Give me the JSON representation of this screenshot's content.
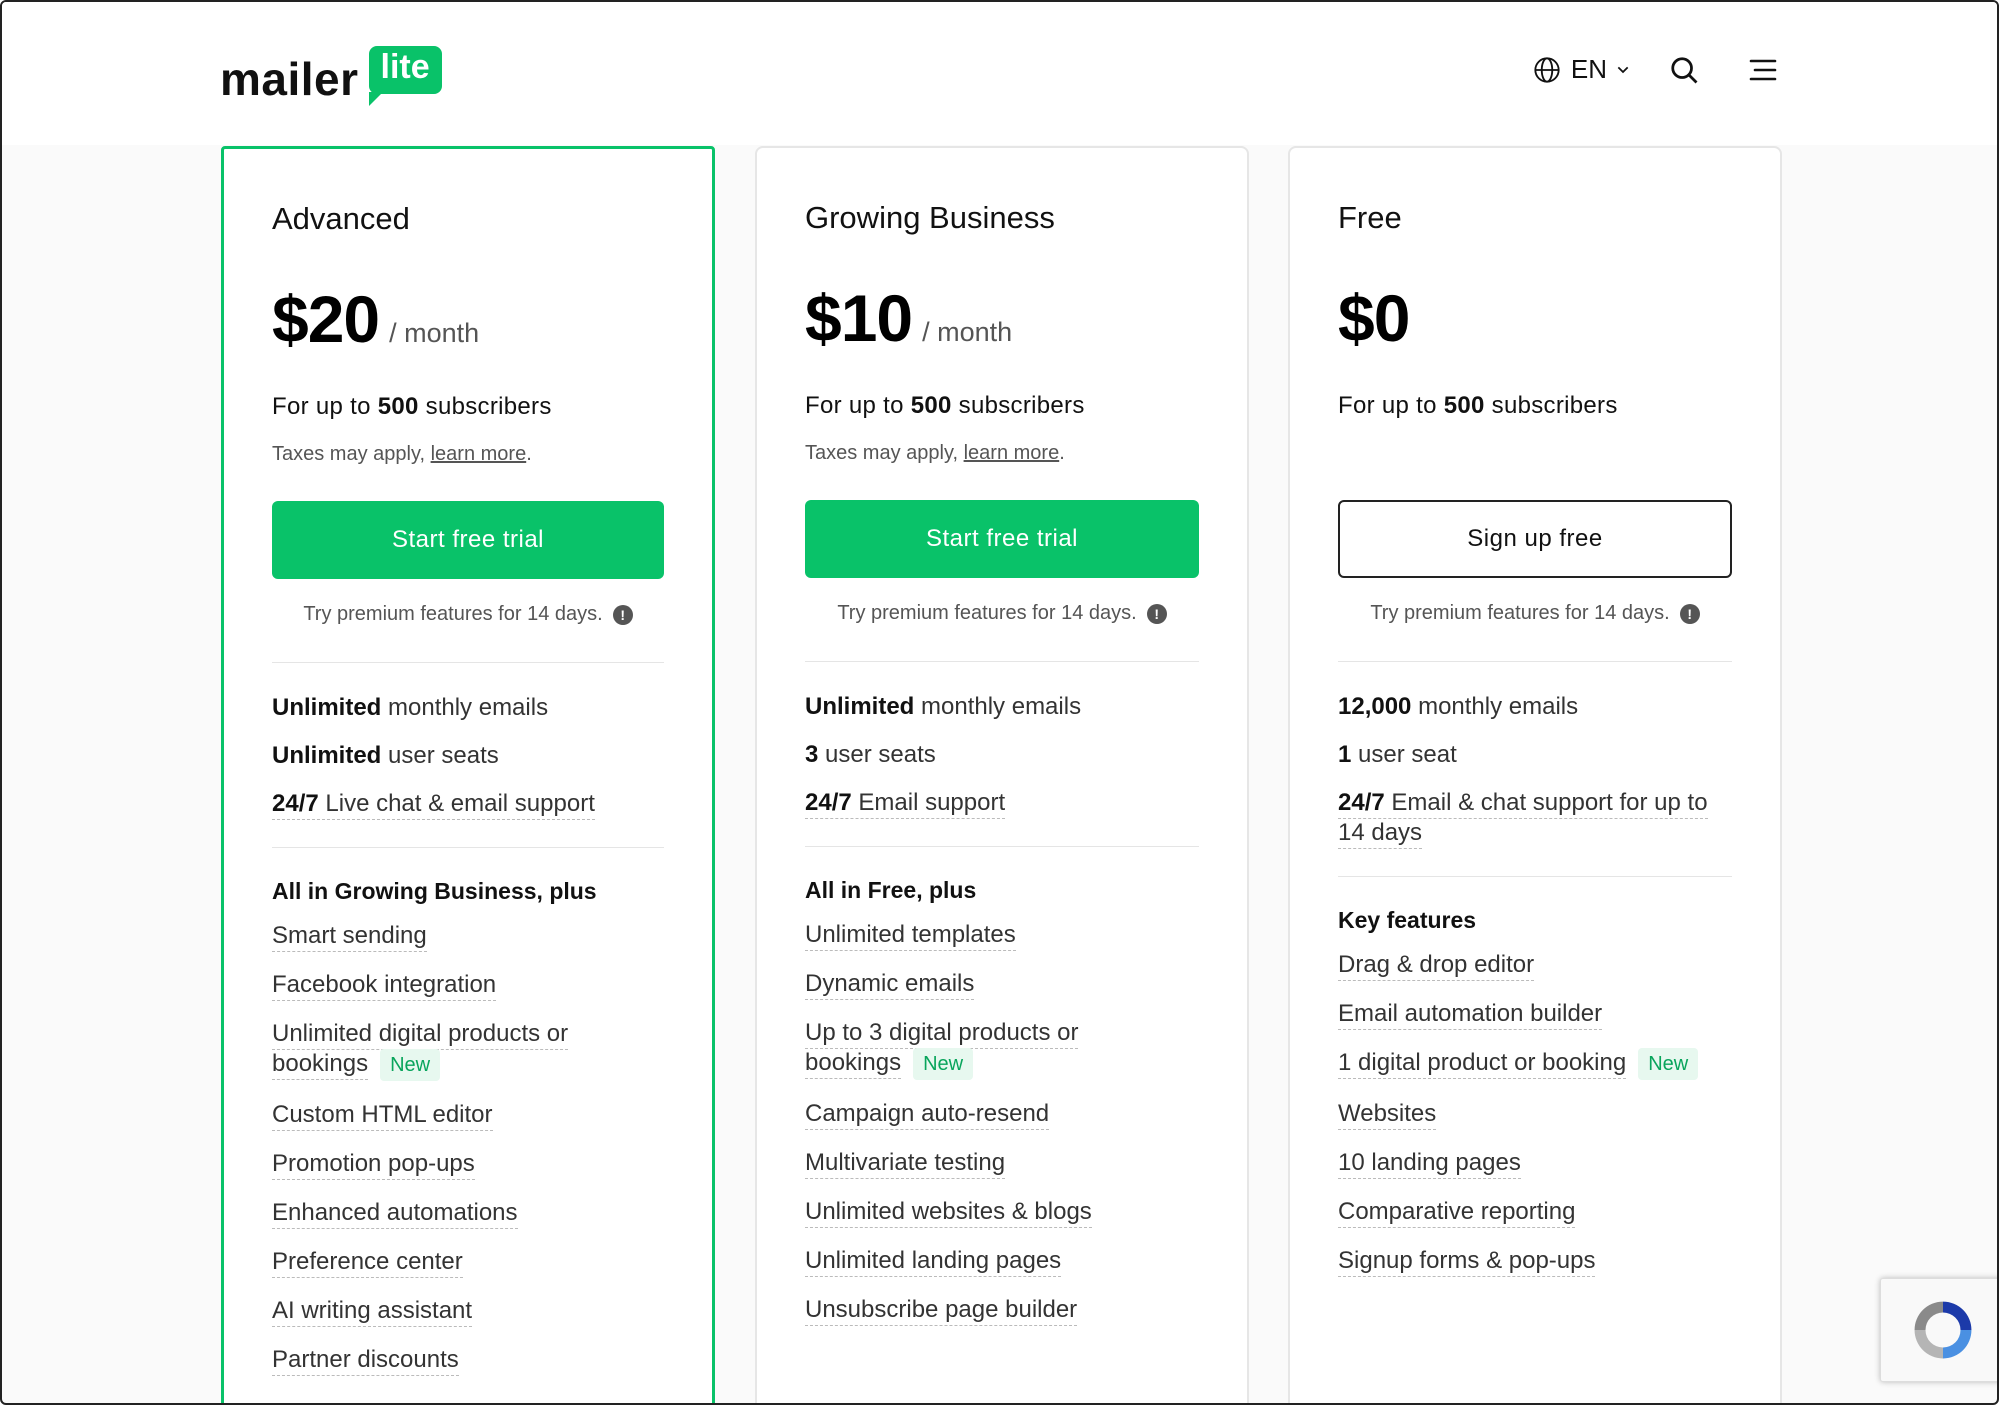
{
  "header": {
    "logo_word": "mailer",
    "logo_badge": "lite",
    "language": "EN"
  },
  "plans": [
    {
      "name": "Advanced",
      "price": "$20",
      "per": "/ month",
      "subs_prefix": "For up to ",
      "subs_count": "500",
      "subs_suffix": " subscribers",
      "tax_text": "Taxes may apply, ",
      "tax_link": "learn more",
      "cta": "Start free trial",
      "trial": "Try premium features for 14 days.",
      "quotas": [
        {
          "bold": "Unlimited",
          "rest": " monthly emails"
        },
        {
          "bold": "Unlimited",
          "rest": " user seats"
        },
        {
          "bold": "24/7",
          "rest": " Live chat & email support"
        }
      ],
      "section_title": "All in Growing Business, plus",
      "features": [
        "Smart sending",
        "Facebook integration",
        "Unlimited digital products or bookings",
        "Custom HTML editor",
        "Promotion pop-ups",
        "Enhanced automations",
        "Preference center",
        "AI writing assistant",
        "Partner discounts"
      ]
    },
    {
      "name": "Growing Business",
      "price": "$10",
      "per": "/ month",
      "subs_prefix": "For up to ",
      "subs_count": "500",
      "subs_suffix": " subscribers",
      "tax_text": "Taxes may apply, ",
      "tax_link": "learn more",
      "cta": "Start free trial",
      "trial": "Try premium features for 14 days.",
      "quotas": [
        {
          "bold": "Unlimited",
          "rest": " monthly emails"
        },
        {
          "bold": "3",
          "rest": " user seats"
        },
        {
          "bold": "24/7",
          "rest": " Email support"
        }
      ],
      "section_title": "All in Free, plus",
      "features": [
        "Unlimited templates",
        "Dynamic emails",
        "Up to 3 digital products or bookings",
        "Campaign auto-resend",
        "Multivariate testing",
        "Unlimited websites & blogs",
        "Unlimited landing pages",
        "Unsubscribe page builder"
      ]
    },
    {
      "name": "Free",
      "price": "$0",
      "subs_prefix": "For up to ",
      "subs_count": "500",
      "subs_suffix": " subscribers",
      "cta": "Sign up free",
      "trial": "Try premium features for 14 days.",
      "quotas": [
        {
          "bold": "12,000",
          "rest": " monthly emails"
        },
        {
          "bold": "1",
          "rest": " user seat"
        },
        {
          "bold": "24/7",
          "rest": " Email & chat support for up to 14 days"
        }
      ],
      "section_title": "Key features",
      "features": [
        "Drag & drop editor",
        "Email automation builder",
        "1 digital product or booking",
        "Websites",
        "10 landing pages",
        "Comparative reporting",
        "Signup forms & pop-ups"
      ]
    }
  ],
  "new_badge": "New",
  "colors": {
    "brand": "#09c269",
    "badge_bg": "#e7f8ef"
  }
}
